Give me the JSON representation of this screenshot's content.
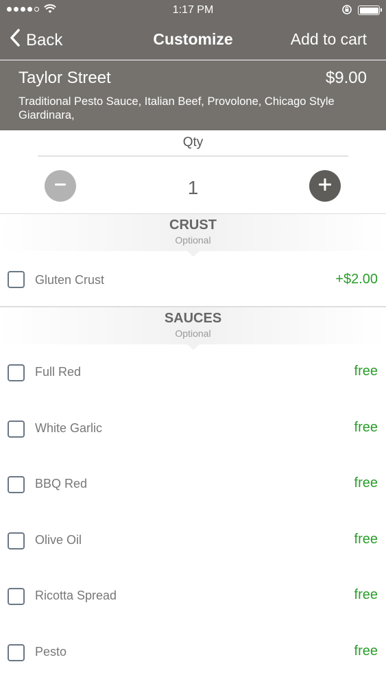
{
  "status_bar": {
    "time": "1:17 PM",
    "signal_dots_filled": 4,
    "signal_dots_total": 5
  },
  "nav": {
    "back_label": "Back",
    "title": "Customize",
    "add_to_cart_label": "Add to cart"
  },
  "item": {
    "name": "Taylor Street",
    "price": "$9.00",
    "description": "Traditional Pesto Sauce, Italian Beef, Provolone, Chicago Style Giardinara,"
  },
  "quantity": {
    "label": "Qty",
    "value": "1"
  },
  "sections": [
    {
      "title": "CRUST",
      "subtitle": "Optional",
      "options": [
        {
          "label": "Gluten Crust",
          "price": "+$2.00"
        }
      ]
    },
    {
      "title": "SAUCES",
      "subtitle": "Optional",
      "options": [
        {
          "label": "Full Red",
          "price": "free"
        },
        {
          "label": "White Garlic",
          "price": "free"
        },
        {
          "label": "BBQ Red",
          "price": "free"
        },
        {
          "label": "Olive Oil",
          "price": "free"
        },
        {
          "label": "Ricotta Spread",
          "price": "free"
        },
        {
          "label": "Pesto",
          "price": "free"
        }
      ]
    }
  ],
  "colors": {
    "nav_background": "#6f6c69",
    "header_background": "#75726e",
    "price_green": "#2a9d2a",
    "plus_button": "#5f5d5a",
    "minus_button": "#b3b3b3"
  },
  "icons": [
    "signal-dots-icon",
    "wifi-icon",
    "orientation-lock-icon",
    "battery-icon",
    "chevron-left-icon",
    "minus-icon",
    "plus-icon",
    "checkbox-icon"
  ]
}
